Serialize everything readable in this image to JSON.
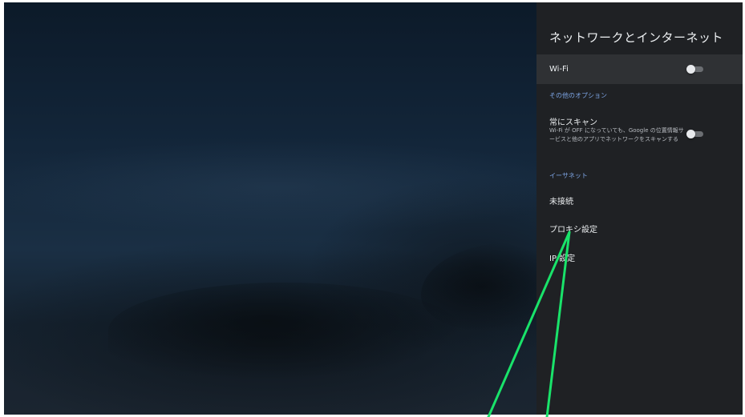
{
  "panel": {
    "title": "ネットワークとインターネット",
    "wifi": {
      "label": "Wi-Fi",
      "enabled": false
    },
    "other_options_header": "その他のオプション",
    "always_scan": {
      "title": "常にスキャン",
      "description": "Wi-Fi が OFF になっていても、Google の位置情報サービスと他のアプリでネットワークをスキャンする",
      "enabled": false
    },
    "ethernet_header": "イーサネット",
    "ethernet_items": [
      {
        "label": "未接続"
      },
      {
        "label": "プロキシ設定"
      },
      {
        "label": "IP 設定"
      }
    ]
  },
  "colors": {
    "panel_bg": "#1f2124",
    "selected_row_bg": "#2f3134",
    "section_header": "#7ea6e6",
    "annotation_line": "#19e36a"
  }
}
